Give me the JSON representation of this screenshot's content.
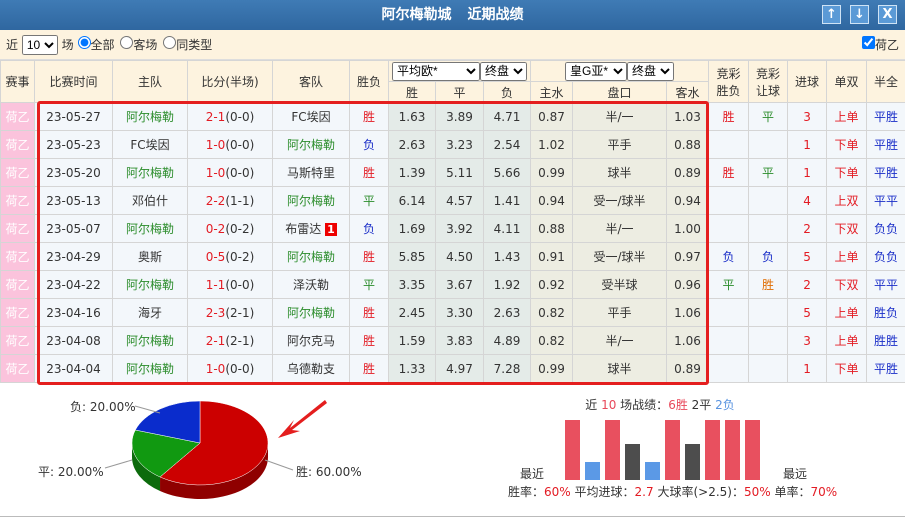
{
  "title": {
    "team": "阿尔梅勒城",
    "label": "近期战绩",
    "buttons": {
      "up": "↑",
      "down": "↓",
      "close": "X"
    }
  },
  "filter": {
    "prefix": "近",
    "count": "10",
    "suffix": "场",
    "options": [
      "全部",
      "客场",
      "同类型"
    ],
    "selected": "全部",
    "league_checkbox": "荷乙",
    "league_checked": true
  },
  "headers": {
    "league": "赛事",
    "time": "比赛时间",
    "home": "主队",
    "score": "比分(半场)",
    "away": "客队",
    "result": "胜负",
    "euro_company": "平均欧*",
    "euro_stage": "终盘",
    "asia_company": "皇G亚*",
    "asia_stage": "终盘",
    "win": "胜",
    "draw": "平",
    "lose": "负",
    "home_water": "主水",
    "handicap": "盘口",
    "away_water": "客水",
    "jc_result_1": "竞彩",
    "jc_result_2": "胜负",
    "jc_hcp_1": "竞彩",
    "jc_hcp_2": "让球",
    "goals": "进球",
    "oe": "单双",
    "hf": "半全"
  },
  "rows": [
    {
      "league": "荷乙",
      "date": "23-05-27",
      "home": "阿尔梅勒",
      "home_c": "green",
      "score": "2-1",
      "half": "(0-0)",
      "away": "FC埃因",
      "away_c": "",
      "badge": "",
      "result": "胜",
      "w": "1.63",
      "d": "3.89",
      "l": "4.71",
      "hw": "0.87",
      "hcp": "半/一",
      "aw": "1.03",
      "jcr": "胜",
      "jch": "平",
      "goals": "3",
      "oe": "上单",
      "hf": "平胜"
    },
    {
      "league": "荷乙",
      "date": "23-05-23",
      "home": "FC埃因",
      "home_c": "",
      "score": "1-0",
      "half": "(0-0)",
      "away": "阿尔梅勒",
      "away_c": "green",
      "badge": "",
      "result": "负",
      "w": "2.63",
      "d": "3.23",
      "l": "2.54",
      "hw": "1.02",
      "hcp": "平手",
      "aw": "0.88",
      "jcr": "",
      "jch": "",
      "goals": "1",
      "oe": "下单",
      "hf": "平胜"
    },
    {
      "league": "荷乙",
      "date": "23-05-20",
      "home": "阿尔梅勒",
      "home_c": "green",
      "score": "1-0",
      "half": "(0-0)",
      "away": "马斯特里",
      "away_c": "",
      "badge": "",
      "result": "胜",
      "w": "1.39",
      "d": "5.11",
      "l": "5.66",
      "hw": "0.99",
      "hcp": "球半",
      "aw": "0.89",
      "jcr": "胜",
      "jch": "平",
      "goals": "1",
      "oe": "下单",
      "hf": "平胜"
    },
    {
      "league": "荷乙",
      "date": "23-05-13",
      "home": "邓伯什",
      "home_c": "",
      "score": "2-2",
      "half": "(1-1)",
      "away": "阿尔梅勒",
      "away_c": "green",
      "badge": "",
      "result": "平",
      "w": "6.14",
      "d": "4.57",
      "l": "1.41",
      "hw": "0.94",
      "hcp": "受一/球半",
      "aw": "0.94",
      "jcr": "",
      "jch": "",
      "goals": "4",
      "oe": "上双",
      "hf": "平平"
    },
    {
      "league": "荷乙",
      "date": "23-05-07",
      "home": "阿尔梅勒",
      "home_c": "green",
      "score": "0-2",
      "half": "(0-2)",
      "away": "布雷达",
      "away_c": "",
      "badge": "1",
      "result": "负",
      "w": "1.69",
      "d": "3.92",
      "l": "4.11",
      "hw": "0.88",
      "hcp": "半/一",
      "aw": "1.00",
      "jcr": "",
      "jch": "",
      "goals": "2",
      "oe": "下双",
      "hf": "负负"
    },
    {
      "league": "荷乙",
      "date": "23-04-29",
      "home": "奥斯",
      "home_c": "",
      "score": "0-5",
      "half": "(0-2)",
      "away": "阿尔梅勒",
      "away_c": "green",
      "badge": "",
      "result": "胜",
      "w": "5.85",
      "d": "4.50",
      "l": "1.43",
      "hw": "0.91",
      "hcp": "受一/球半",
      "aw": "0.97",
      "jcr": "负",
      "jch": "负",
      "goals": "5",
      "oe": "上单",
      "hf": "负负"
    },
    {
      "league": "荷乙",
      "date": "23-04-22",
      "home": "阿尔梅勒",
      "home_c": "green",
      "score": "1-1",
      "half": "(0-0)",
      "away": "泽沃勒",
      "away_c": "",
      "badge": "",
      "result": "平",
      "w": "3.35",
      "d": "3.67",
      "l": "1.92",
      "hw": "0.92",
      "hcp": "受半球",
      "aw": "0.96",
      "jcr": "平",
      "jch": "胜",
      "goals": "2",
      "oe": "下双",
      "hf": "平平"
    },
    {
      "league": "荷乙",
      "date": "23-04-16",
      "home": "海牙",
      "home_c": "",
      "score": "2-3",
      "half": "(2-1)",
      "away": "阿尔梅勒",
      "away_c": "green",
      "badge": "",
      "result": "胜",
      "w": "2.45",
      "d": "3.30",
      "l": "2.63",
      "hw": "0.82",
      "hcp": "平手",
      "aw": "1.06",
      "jcr": "",
      "jch": "",
      "goals": "5",
      "oe": "上单",
      "hf": "胜负"
    },
    {
      "league": "荷乙",
      "date": "23-04-08",
      "home": "阿尔梅勒",
      "home_c": "green",
      "score": "2-1",
      "half": "(2-1)",
      "away": "阿尔克马",
      "away_c": "",
      "badge": "",
      "result": "胜",
      "w": "1.59",
      "d": "3.83",
      "l": "4.89",
      "hw": "0.82",
      "hcp": "半/一",
      "aw": "1.06",
      "jcr": "",
      "jch": "",
      "goals": "3",
      "oe": "上单",
      "hf": "胜胜"
    },
    {
      "league": "荷乙",
      "date": "23-04-04",
      "home": "阿尔梅勒",
      "home_c": "green",
      "score": "1-0",
      "half": "(0-0)",
      "away": "乌德勒支",
      "away_c": "",
      "badge": "",
      "result": "胜",
      "w": "1.33",
      "d": "4.97",
      "l": "7.28",
      "hw": "0.99",
      "hcp": "球半",
      "aw": "0.89",
      "jcr": "",
      "jch": "",
      "goals": "1",
      "oe": "下单",
      "hf": "平胜"
    }
  ],
  "pie": {
    "lose_label": "负: 20.00%",
    "draw_label": "平: 20.00%",
    "win_label": "胜: 60.00%",
    "win": 60,
    "draw": 20,
    "lose": 20,
    "colors": {
      "win": "#cc0000",
      "draw": "#119911",
      "lose": "#0a2ccc"
    }
  },
  "summary": {
    "prefix": "近",
    "count": "10",
    "mid": "场战绩：",
    "wins": "6胜",
    "draws": "2平",
    "losses": "2负",
    "sequence": [
      "胜",
      "负",
      "胜",
      "平",
      "负",
      "胜",
      "平",
      "胜",
      "胜",
      "胜"
    ],
    "recent": "最近",
    "oldest": "最远"
  },
  "stats": {
    "win_rate_label": "胜率：",
    "win_rate": "60%",
    "avg_goals_label": "平均进球：",
    "avg_goals": "2.7",
    "over_label": "大球率(>2.5)：",
    "over": "50%",
    "odd_label": "单率：",
    "odd": "70%"
  }
}
